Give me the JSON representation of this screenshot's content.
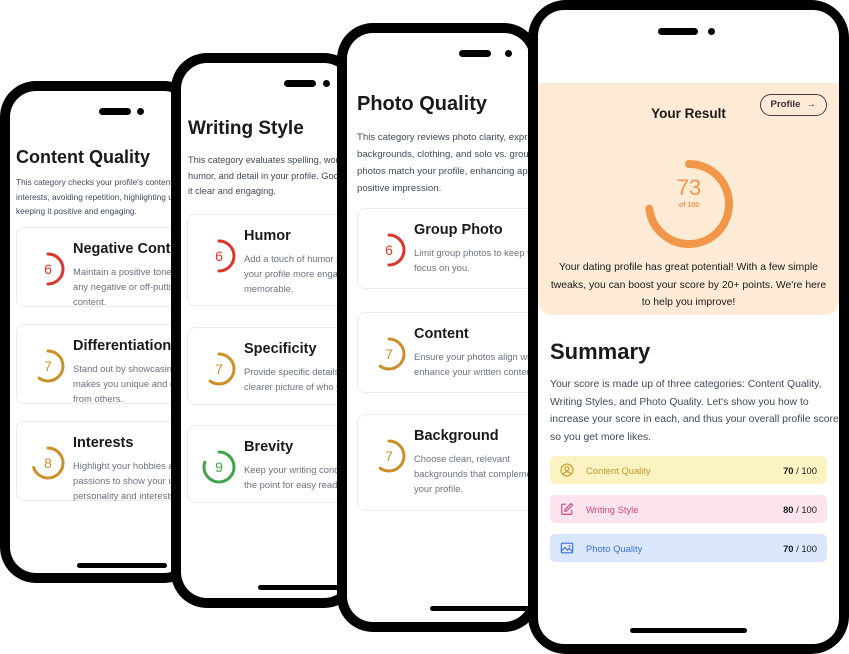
{
  "colors": {
    "red": "#d9372b",
    "amber": "#cc8f2a",
    "green": "#3fa54a",
    "orange": "#f0974a",
    "result_bg": "#fdebd6",
    "content_bg": "#fcf3c2",
    "content_fg": "#c7962a",
    "writing_bg": "#fbe4ee",
    "writing_fg": "#d4457f",
    "photo_bg": "#dbe7fb",
    "photo_fg": "#3b73d6"
  },
  "screens": {
    "content_quality": {
      "title": "Content Quality",
      "desc_lines": [
        "This category checks your profile's content,",
        "interests, avoiding repetition, highlighting un",
        "keeping it positive and engaging."
      ],
      "cards": [
        {
          "score": "6",
          "title": "Negative Content",
          "desc": [
            "Maintain a positive tone, avoid",
            "any negative or off-putting",
            "content."
          ]
        },
        {
          "score": "7",
          "title": "Differentiation",
          "desc": [
            "Stand out by showcasing what",
            "makes you unique and different",
            "from others."
          ]
        },
        {
          "score": "8",
          "title": "Interests",
          "desc": [
            "Highlight your hobbies and",
            "passions to show your unique",
            "personality and interests."
          ]
        }
      ]
    },
    "writing_style": {
      "title": "Writing Style",
      "desc_lines": [
        "This category evaluates spelling, wor",
        "humor, and detail in your profile. Goo",
        "it clear and engaging."
      ],
      "cards": [
        {
          "score": "6",
          "title": "Humor",
          "desc": [
            "Add a touch of humor to make",
            "your profile more engaging and",
            "memorable."
          ]
        },
        {
          "score": "7",
          "title": "Specificity",
          "desc": [
            "Provide specific details for a",
            "clearer picture of who you are."
          ]
        },
        {
          "score": "9",
          "title": "Brevity",
          "desc": [
            "Keep your writing concise and to",
            "the point for easy reading."
          ]
        }
      ]
    },
    "photo_quality": {
      "title": "Photo Quality",
      "desc_lines": [
        "This category reviews photo clarity, expr",
        "backgrounds, clothing, and solo vs. grou",
        "photos match your profile, enhancing ap",
        "positive impression."
      ],
      "cards": [
        {
          "score": "6",
          "title": "Group Photo",
          "desc": [
            "Limit group photos to keep the",
            "focus on you."
          ]
        },
        {
          "score": "7",
          "title": "Content",
          "desc": [
            "Ensure your photos align with and",
            "enhance your written content."
          ]
        },
        {
          "score": "7",
          "title": "Background",
          "desc": [
            "Choose clean, relevant",
            "backgrounds that complement",
            "your profile."
          ]
        }
      ]
    },
    "result": {
      "title": "Your Result",
      "profile_button": "Profile",
      "profile_arrow": "→",
      "score": "73",
      "score_max_label": "of 100",
      "score_fraction": 0.73,
      "message": "Your dating profile has great potential! With a few simple tweaks, you can boost your score by 20+ points. We're here to help you improve!",
      "summary_title": "Summary",
      "summary_desc": "Your score is made up of three categories: Content Quality, Writing Styles, and Photo Quality. Let's show you how to increase your score in each, and thus your overall profile score so you get more likes.",
      "summary_rows": [
        {
          "icon": "user-circle-icon",
          "label": "Content Quality",
          "value": "70",
          "max": " / 100"
        },
        {
          "icon": "pencil-square-icon",
          "label": "Writing Style",
          "value": "80",
          "max": " / 100"
        },
        {
          "icon": "image-icon",
          "label": "Photo Quality",
          "value": "70",
          "max": " / 100"
        }
      ]
    }
  }
}
